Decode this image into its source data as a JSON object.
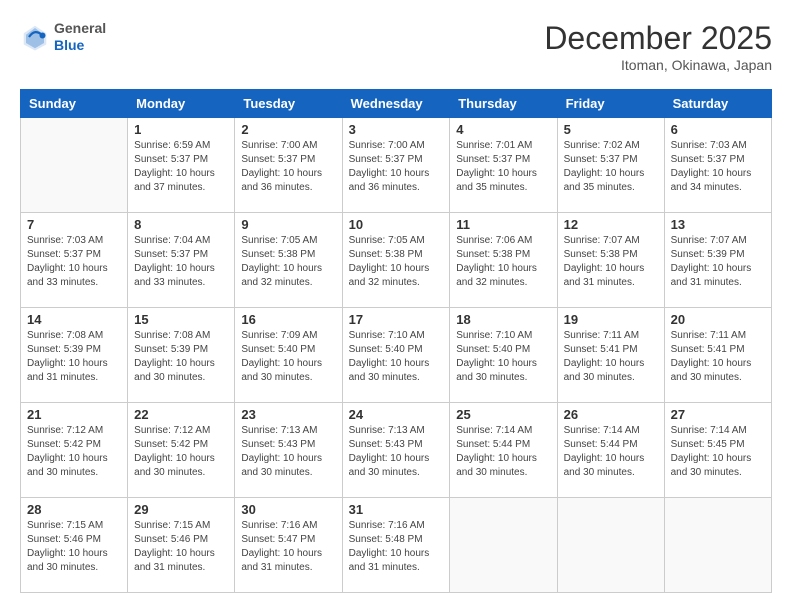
{
  "header": {
    "logo_general": "General",
    "logo_blue": "Blue",
    "month_title": "December 2025",
    "location": "Itoman, Okinawa, Japan"
  },
  "weekdays": [
    "Sunday",
    "Monday",
    "Tuesday",
    "Wednesday",
    "Thursday",
    "Friday",
    "Saturday"
  ],
  "weeks": [
    [
      {
        "day": "",
        "sunrise": "",
        "sunset": "",
        "daylight": ""
      },
      {
        "day": "1",
        "sunrise": "Sunrise: 6:59 AM",
        "sunset": "Sunset: 5:37 PM",
        "daylight": "Daylight: 10 hours and 37 minutes."
      },
      {
        "day": "2",
        "sunrise": "Sunrise: 7:00 AM",
        "sunset": "Sunset: 5:37 PM",
        "daylight": "Daylight: 10 hours and 36 minutes."
      },
      {
        "day": "3",
        "sunrise": "Sunrise: 7:00 AM",
        "sunset": "Sunset: 5:37 PM",
        "daylight": "Daylight: 10 hours and 36 minutes."
      },
      {
        "day": "4",
        "sunrise": "Sunrise: 7:01 AM",
        "sunset": "Sunset: 5:37 PM",
        "daylight": "Daylight: 10 hours and 35 minutes."
      },
      {
        "day": "5",
        "sunrise": "Sunrise: 7:02 AM",
        "sunset": "Sunset: 5:37 PM",
        "daylight": "Daylight: 10 hours and 35 minutes."
      },
      {
        "day": "6",
        "sunrise": "Sunrise: 7:03 AM",
        "sunset": "Sunset: 5:37 PM",
        "daylight": "Daylight: 10 hours and 34 minutes."
      }
    ],
    [
      {
        "day": "7",
        "sunrise": "Sunrise: 7:03 AM",
        "sunset": "Sunset: 5:37 PM",
        "daylight": "Daylight: 10 hours and 33 minutes."
      },
      {
        "day": "8",
        "sunrise": "Sunrise: 7:04 AM",
        "sunset": "Sunset: 5:37 PM",
        "daylight": "Daylight: 10 hours and 33 minutes."
      },
      {
        "day": "9",
        "sunrise": "Sunrise: 7:05 AM",
        "sunset": "Sunset: 5:38 PM",
        "daylight": "Daylight: 10 hours and 32 minutes."
      },
      {
        "day": "10",
        "sunrise": "Sunrise: 7:05 AM",
        "sunset": "Sunset: 5:38 PM",
        "daylight": "Daylight: 10 hours and 32 minutes."
      },
      {
        "day": "11",
        "sunrise": "Sunrise: 7:06 AM",
        "sunset": "Sunset: 5:38 PM",
        "daylight": "Daylight: 10 hours and 32 minutes."
      },
      {
        "day": "12",
        "sunrise": "Sunrise: 7:07 AM",
        "sunset": "Sunset: 5:38 PM",
        "daylight": "Daylight: 10 hours and 31 minutes."
      },
      {
        "day": "13",
        "sunrise": "Sunrise: 7:07 AM",
        "sunset": "Sunset: 5:39 PM",
        "daylight": "Daylight: 10 hours and 31 minutes."
      }
    ],
    [
      {
        "day": "14",
        "sunrise": "Sunrise: 7:08 AM",
        "sunset": "Sunset: 5:39 PM",
        "daylight": "Daylight: 10 hours and 31 minutes."
      },
      {
        "day": "15",
        "sunrise": "Sunrise: 7:08 AM",
        "sunset": "Sunset: 5:39 PM",
        "daylight": "Daylight: 10 hours and 30 minutes."
      },
      {
        "day": "16",
        "sunrise": "Sunrise: 7:09 AM",
        "sunset": "Sunset: 5:40 PM",
        "daylight": "Daylight: 10 hours and 30 minutes."
      },
      {
        "day": "17",
        "sunrise": "Sunrise: 7:10 AM",
        "sunset": "Sunset: 5:40 PM",
        "daylight": "Daylight: 10 hours and 30 minutes."
      },
      {
        "day": "18",
        "sunrise": "Sunrise: 7:10 AM",
        "sunset": "Sunset: 5:40 PM",
        "daylight": "Daylight: 10 hours and 30 minutes."
      },
      {
        "day": "19",
        "sunrise": "Sunrise: 7:11 AM",
        "sunset": "Sunset: 5:41 PM",
        "daylight": "Daylight: 10 hours and 30 minutes."
      },
      {
        "day": "20",
        "sunrise": "Sunrise: 7:11 AM",
        "sunset": "Sunset: 5:41 PM",
        "daylight": "Daylight: 10 hours and 30 minutes."
      }
    ],
    [
      {
        "day": "21",
        "sunrise": "Sunrise: 7:12 AM",
        "sunset": "Sunset: 5:42 PM",
        "daylight": "Daylight: 10 hours and 30 minutes."
      },
      {
        "day": "22",
        "sunrise": "Sunrise: 7:12 AM",
        "sunset": "Sunset: 5:42 PM",
        "daylight": "Daylight: 10 hours and 30 minutes."
      },
      {
        "day": "23",
        "sunrise": "Sunrise: 7:13 AM",
        "sunset": "Sunset: 5:43 PM",
        "daylight": "Daylight: 10 hours and 30 minutes."
      },
      {
        "day": "24",
        "sunrise": "Sunrise: 7:13 AM",
        "sunset": "Sunset: 5:43 PM",
        "daylight": "Daylight: 10 hours and 30 minutes."
      },
      {
        "day": "25",
        "sunrise": "Sunrise: 7:14 AM",
        "sunset": "Sunset: 5:44 PM",
        "daylight": "Daylight: 10 hours and 30 minutes."
      },
      {
        "day": "26",
        "sunrise": "Sunrise: 7:14 AM",
        "sunset": "Sunset: 5:44 PM",
        "daylight": "Daylight: 10 hours and 30 minutes."
      },
      {
        "day": "27",
        "sunrise": "Sunrise: 7:14 AM",
        "sunset": "Sunset: 5:45 PM",
        "daylight": "Daylight: 10 hours and 30 minutes."
      }
    ],
    [
      {
        "day": "28",
        "sunrise": "Sunrise: 7:15 AM",
        "sunset": "Sunset: 5:46 PM",
        "daylight": "Daylight: 10 hours and 30 minutes."
      },
      {
        "day": "29",
        "sunrise": "Sunrise: 7:15 AM",
        "sunset": "Sunset: 5:46 PM",
        "daylight": "Daylight: 10 hours and 31 minutes."
      },
      {
        "day": "30",
        "sunrise": "Sunrise: 7:16 AM",
        "sunset": "Sunset: 5:47 PM",
        "daylight": "Daylight: 10 hours and 31 minutes."
      },
      {
        "day": "31",
        "sunrise": "Sunrise: 7:16 AM",
        "sunset": "Sunset: 5:48 PM",
        "daylight": "Daylight: 10 hours and 31 minutes."
      },
      {
        "day": "",
        "sunrise": "",
        "sunset": "",
        "daylight": ""
      },
      {
        "day": "",
        "sunrise": "",
        "sunset": "",
        "daylight": ""
      },
      {
        "day": "",
        "sunrise": "",
        "sunset": "",
        "daylight": ""
      }
    ]
  ]
}
